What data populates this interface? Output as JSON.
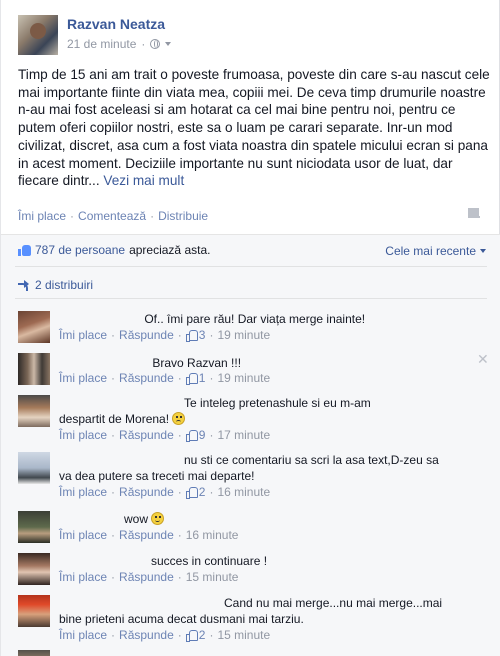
{
  "post": {
    "author": "Razvan Neatza",
    "time": "21 de minute",
    "text": "Timp de 15 ani am trait o poveste frumoasa, poveste din care s-au nascut cele mai importante fiinte din viata mea, copiii mei. De ceva timp drumurile noastre n-au mai fost aceleasi si am hotarat ca cel mai bine pentru noi, pentru ce putem oferi copiilor nostri, este sa o luam pe carari separate. Inr-un mod civilizat, discret, asa cum a fost viata noastra din spatele micului ecran si pana in acest moment. Deciziile importante nu sunt niciodata usor de luat, dar fiecare dintr...",
    "see_more": "Vezi mai mult",
    "actions": {
      "like": "Îmi place",
      "comment": "Comentează",
      "share": "Distribuie"
    }
  },
  "ufi": {
    "likes_count": "787 de persoane",
    "likes_suffix": "apreciază asta.",
    "sort_label": "Cele mai recente",
    "shares": "2 distribuiri"
  },
  "comment_labels": {
    "like": "Îmi place",
    "reply": "Răspunde"
  },
  "comments": [
    {
      "text": "Of.. îmi pare rău! Dar viața merge inainte!",
      "likes": "3",
      "time": "19 minute"
    },
    {
      "text": "Bravo Razvan !!!",
      "likes": "1",
      "time": "19 minute"
    },
    {
      "text": "Te inteleg pretenashule si eu m-am despartit de Morena!",
      "likes": "9",
      "time": "17 minute",
      "emoji": "sad"
    },
    {
      "text": "nu sti ce comentariu sa scri la asa text,D-zeu sa va dea putere sa treceti mai departe!",
      "likes": "2",
      "time": "16 minute"
    },
    {
      "text": "wow",
      "likes": "",
      "time": "16 minute",
      "emoji": "happy"
    },
    {
      "text": "succes in continuare !",
      "likes": "",
      "time": "15 minute"
    },
    {
      "text": "Cand nu mai merge...nu mai merge...mai bine prieteni acuma decat dusmani mai tarziu.",
      "likes": "2",
      "time": "15 minute"
    }
  ]
}
